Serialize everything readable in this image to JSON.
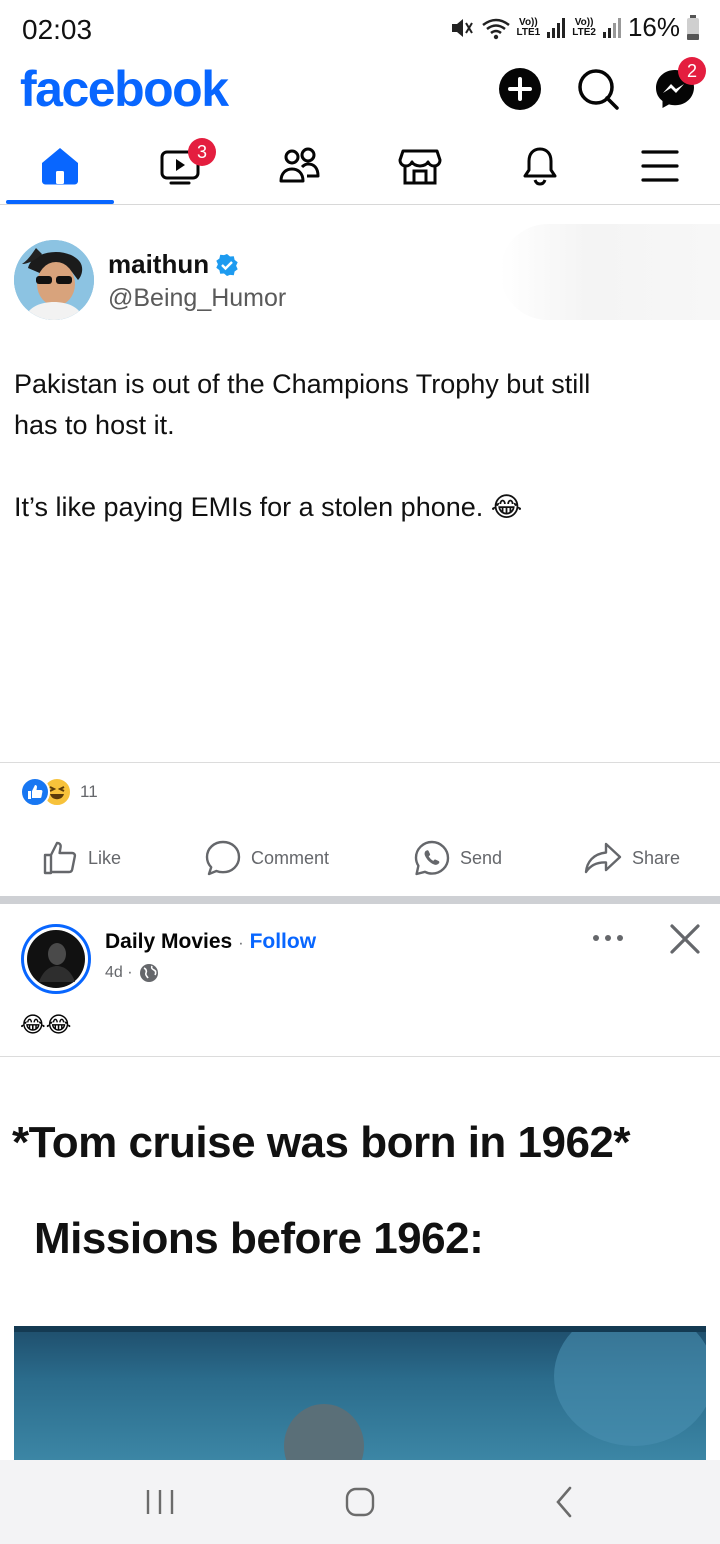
{
  "status_bar": {
    "time": "02:03",
    "battery": "16%",
    "sim1": {
      "volte": "Vo))",
      "type": "LTE1"
    },
    "sim2": {
      "volte": "Vo))",
      "type": "LTE2"
    }
  },
  "header": {
    "logo": "facebook",
    "messenger_badge": "2"
  },
  "tabs": {
    "video_badge": "3",
    "items": [
      "home-icon",
      "video-icon",
      "friends-icon",
      "marketplace-icon",
      "notifications-icon",
      "menu-icon"
    ]
  },
  "post1": {
    "author_name": "maithun",
    "author_handle": "@Being_Humor",
    "text_line1": "Pakistan is out of the Champions Trophy but still",
    "text_line2": "has to host it.",
    "text_line3": "It’s like paying EMIs for a stolen phone. 😂",
    "reaction_count": "11",
    "actions": {
      "like": "Like",
      "comment": "Comment",
      "send": "Send",
      "share": "Share"
    }
  },
  "post2": {
    "page_name": "Daily Movies",
    "separator": "·",
    "follow": "Follow",
    "age": "4d ·",
    "caption": "😂😂",
    "image_text_line1": "*Tom cruise was born in 1962*",
    "image_text_line2": "Missions before 1962:"
  },
  "colors": {
    "brand": "#0866ff",
    "badge": "#e41e3f",
    "verified": "#1d9bf0"
  }
}
